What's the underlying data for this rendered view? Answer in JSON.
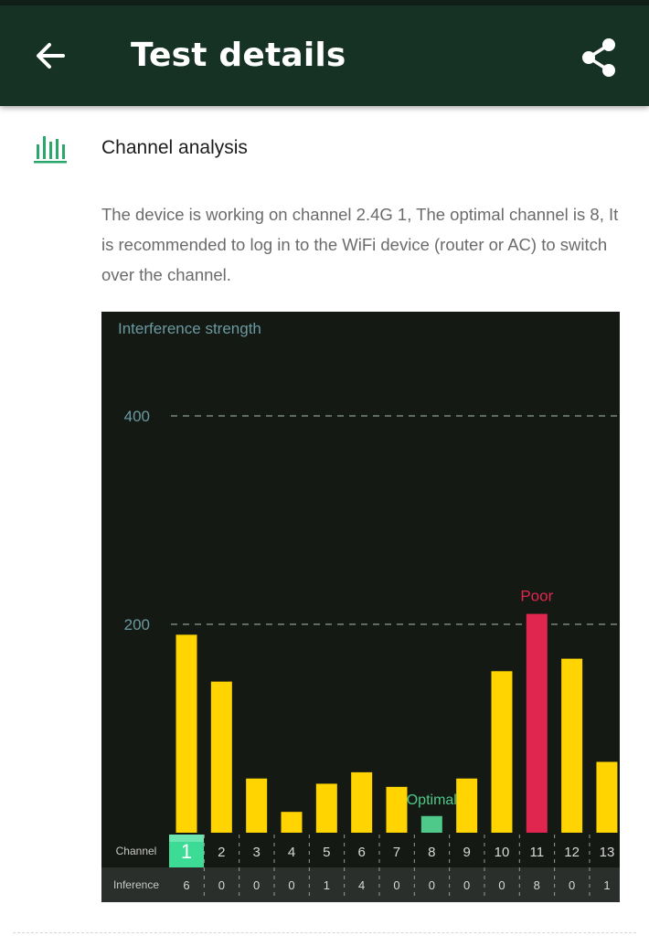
{
  "app_bar": {
    "title": "Test details",
    "back_icon": "arrow-left-icon",
    "share_icon": "share-icon",
    "background_color": "#163224"
  },
  "section": {
    "icon": "bar-chart-icon",
    "title": "Channel analysis",
    "description": "The device is working on channel 2.4G 1, The optimal channel is 8, It is recommended to log in to the WiFi device (router or AC) to switch over the channel."
  },
  "chart_data": {
    "type": "bar",
    "title": "Interference strength",
    "ylabel": "Interference strength",
    "y_ticks": [
      200,
      400
    ],
    "ylim": [
      0,
      500
    ],
    "grid": "dashed at ticks",
    "categories": [
      "1",
      "2",
      "3",
      "4",
      "5",
      "6",
      "7",
      "8",
      "9",
      "10",
      "11",
      "12",
      "13"
    ],
    "values": [
      190,
      145,
      52,
      20,
      47,
      58,
      44,
      16,
      52,
      155,
      210,
      167,
      68
    ],
    "current_channel": "1",
    "optimal_channel": "8",
    "poor_channel": "11",
    "annotations": {
      "optimal": "Optimal",
      "poor": "Poor"
    },
    "row_labels": {
      "channel": "Channel",
      "inference": "Inference"
    },
    "inference_values": [
      "6",
      "0",
      "0",
      "0",
      "1",
      "4",
      "0",
      "0",
      "0",
      "0",
      "8",
      "0",
      "1"
    ],
    "colors": {
      "normal": "#ffd400",
      "poor": "#e0264f",
      "optimal": "#4fc98a",
      "current": "#3ddc96",
      "axis_text": "#6a9aa0",
      "grid": "#7a8582",
      "background": "#151914"
    }
  }
}
